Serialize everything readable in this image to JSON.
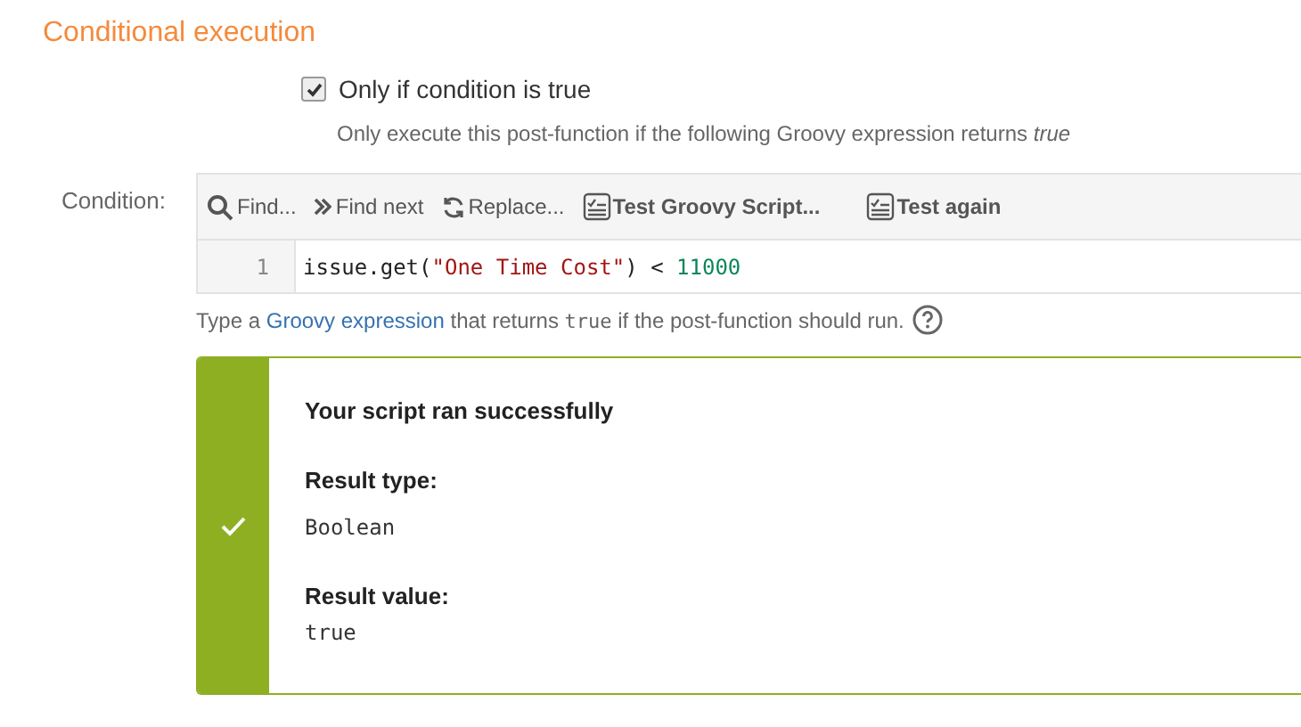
{
  "section_title": "Conditional execution",
  "option": {
    "label": "Only if condition is true",
    "checked": true,
    "description": "Only execute this post-function if the following Groovy expression returns *true*"
  },
  "condition": {
    "label": "Condition:",
    "toolbar": [
      {
        "kind": "search",
        "label": "Find..."
      },
      {
        "kind": "next",
        "label": "Find next"
      },
      {
        "kind": "replace",
        "label": "Replace..."
      },
      {
        "kind": "script",
        "label": "Test Groovy Script..."
      },
      {
        "kind": "script",
        "label": "Test again"
      }
    ],
    "lines": [
      {
        "number": "1",
        "tokens": [
          {
            "kind": "plain",
            "text": "issue.get("
          },
          {
            "kind": "string",
            "text": "\"One Time Cost\""
          },
          {
            "kind": "plain",
            "text": ") < "
          },
          {
            "kind": "number",
            "text": "11000"
          }
        ]
      }
    ],
    "help": [
      {
        "kind": "text",
        "text": "Type a "
      },
      {
        "kind": "link",
        "text": "Groovy expression"
      },
      {
        "kind": "text",
        "text": " that returns "
      },
      {
        "kind": "code",
        "text": "true"
      },
      {
        "kind": "text",
        "text": " if the post-function should run."
      }
    ]
  },
  "result": {
    "succeeded": true,
    "title": "Your script ran successfully",
    "fields": [
      {
        "label": "Result type:",
        "value": "Boolean"
      },
      {
        "label": "Result value:",
        "value": "true"
      }
    ]
  }
}
